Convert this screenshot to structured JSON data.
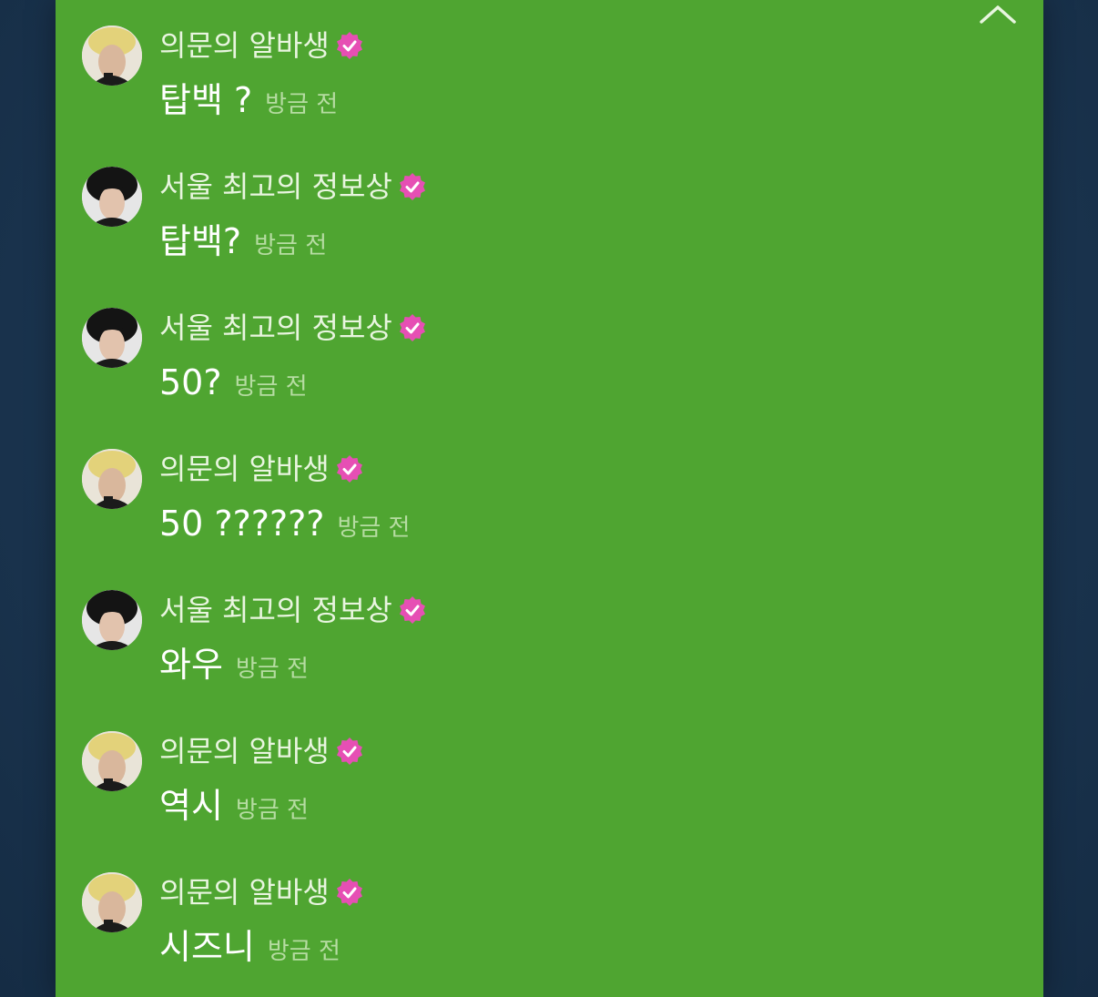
{
  "colors": {
    "panel_bg": "#4fa531",
    "page_bg": "#1d3a55",
    "badge": "#e64fb4",
    "name_text": "#e8f5df",
    "message_text": "#ffffff",
    "time_text": "#b6dca2"
  },
  "header": {
    "collapse_icon": "chevron-up-icon"
  },
  "messages": [
    {
      "author": "의문의 알바생",
      "verified": true,
      "avatar": "blonde",
      "text": "탑백 ?",
      "time": "방금 전"
    },
    {
      "author": "서울 최고의 정보상",
      "verified": true,
      "avatar": "dark",
      "text": "탑백?",
      "time": "방금 전"
    },
    {
      "author": "서울 최고의 정보상",
      "verified": true,
      "avatar": "dark",
      "text": "50?",
      "time": "방금 전"
    },
    {
      "author": "의문의 알바생",
      "verified": true,
      "avatar": "blonde",
      "text": "50 ??????",
      "time": "방금 전"
    },
    {
      "author": "서울 최고의 정보상",
      "verified": true,
      "avatar": "dark",
      "text": "와우",
      "time": "방금 전"
    },
    {
      "author": "의문의 알바생",
      "verified": true,
      "avatar": "blonde",
      "text": "역시",
      "time": "방금 전"
    },
    {
      "author": "의문의 알바생",
      "verified": true,
      "avatar": "blonde",
      "text": "시즈니",
      "time": "방금 전"
    }
  ]
}
